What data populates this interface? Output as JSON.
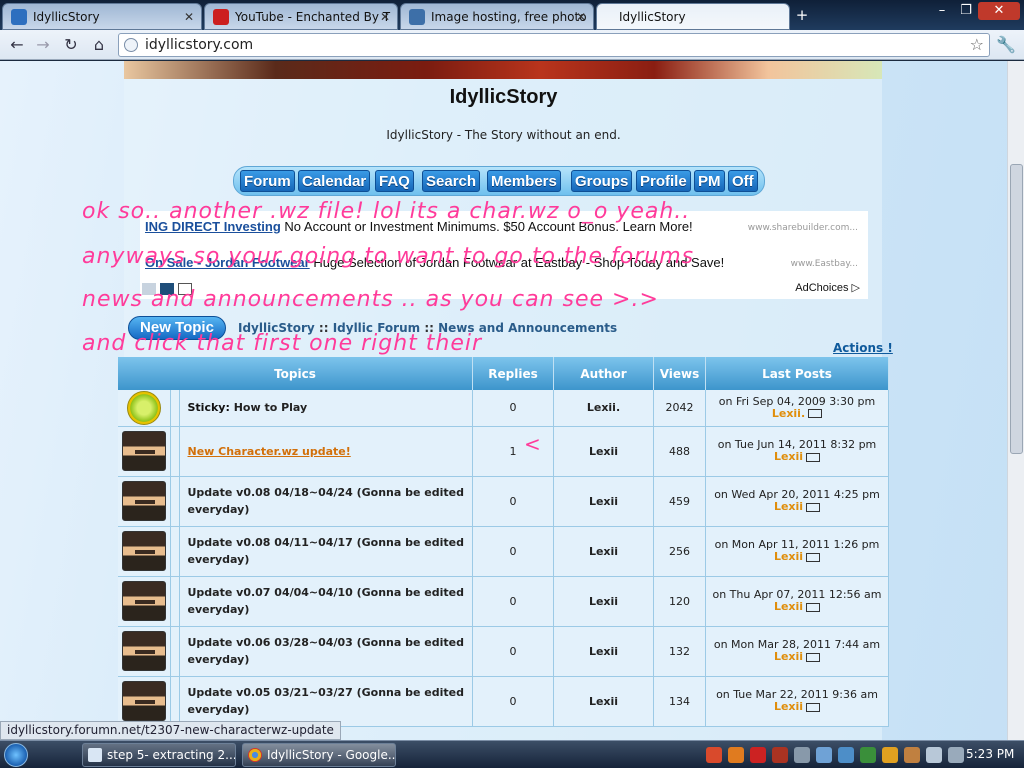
{
  "browser": {
    "tabs": [
      {
        "label": "IdyllicStory",
        "active": false
      },
      {
        "label": "YouTube - Enchanted By T",
        "active": false
      },
      {
        "label": "Image hosting, free photo",
        "active": false
      },
      {
        "label": "IdyllicStory",
        "active": true
      }
    ],
    "new_tab": "+",
    "url": "idyllicstory.com",
    "status_url": "idyllicstory.forumn.net/t2307-new-characterwz-update"
  },
  "page": {
    "site_title": "IdyllicStory",
    "site_description": "IdyllicStory - The Story without an end.",
    "nav": [
      "Forum",
      "Calendar",
      "FAQ",
      "Search",
      "Members",
      "Groups",
      "Profile",
      "PM",
      "Off"
    ],
    "ad": {
      "line1_link": "ING DIRECT Investing",
      "line1_text": " No Account or Investment Minimums. $50 Account Bonus. Learn More!",
      "line1_url": "www.sharebuilder.com...",
      "line2_link": "On Sale - Jordan Footwear",
      "line2_text": " Huge Selection of Jordan Footwear at Eastbay - Shop Today and Save!",
      "line2_url": "www.Eastbay...",
      "adchoices": "AdChoices ▷"
    },
    "new_topic_button": "New Topic",
    "breadcrumb": {
      "site": "IdyllicStory",
      "forum": "Idyllic Forum",
      "section": "News and Announcements",
      "separator": "::"
    },
    "actions_link": "Actions !",
    "table": {
      "headers": [
        "Topics",
        "Replies",
        "Author",
        "Views",
        "Last Posts"
      ],
      "rows": [
        {
          "prefix": "Sticky:",
          "title": "How to Play",
          "replies": "0",
          "author": "Lexii.",
          "views": "2042",
          "last_date": "on Fri Sep 04, 2009 3:30 pm",
          "last_user": "Lexii."
        },
        {
          "prefix": "",
          "title": "New Character.wz update!",
          "replies": "1",
          "author": "Lexii",
          "views": "488",
          "last_date": "on Tue Jun 14, 2011 8:32 pm",
          "last_user": "Lexii"
        },
        {
          "prefix": "",
          "title": "Update v0.08 04/18~04/24 (Gonna be edited everyday)",
          "replies": "0",
          "author": "Lexii",
          "views": "459",
          "last_date": "on Wed Apr 20, 2011 4:25 pm",
          "last_user": "Lexii"
        },
        {
          "prefix": "",
          "title": "Update v0.08 04/11~04/17 (Gonna be edited everyday)",
          "replies": "0",
          "author": "Lexii",
          "views": "256",
          "last_date": "on Mon Apr 11, 2011 1:26 pm",
          "last_user": "Lexii"
        },
        {
          "prefix": "",
          "title": "Update v0.07 04/04~04/10 (Gonna be edited everyday)",
          "replies": "0",
          "author": "Lexii",
          "views": "120",
          "last_date": "on Thu Apr 07, 2011 12:56 am",
          "last_user": "Lexii"
        },
        {
          "prefix": "",
          "title": "Update v0.06 03/28~04/03 (Gonna be edited everyday)",
          "replies": "0",
          "author": "Lexii",
          "views": "132",
          "last_date": "on Mon Mar 28, 2011 7:44 am",
          "last_user": "Lexii"
        },
        {
          "prefix": "",
          "title": "Update v0.05 03/21~03/27 (Gonna be edited everyday)",
          "replies": "0",
          "author": "Lexii",
          "views": "134",
          "last_date": "on Tue Mar 22, 2011 9:36 am",
          "last_user": "Lexii"
        }
      ]
    }
  },
  "annotations": {
    "line1": "ok so.. another .wz file! lol its a char.wz o_o yeah..",
    "line2": "anyways so your going to want to go to the forums",
    "line3": "news and announcements .. as you can see >.>",
    "line4": "and click that first one right their",
    "arrow": "<"
  },
  "taskbar": {
    "buttons": [
      "step 5- extracting 2....",
      "IdyllicStory - Google..."
    ],
    "clock": "5:23 PM"
  },
  "colors": {
    "annotation": "#ff3b9a",
    "author": "#e08e0b",
    "link": "#1d5f98"
  }
}
